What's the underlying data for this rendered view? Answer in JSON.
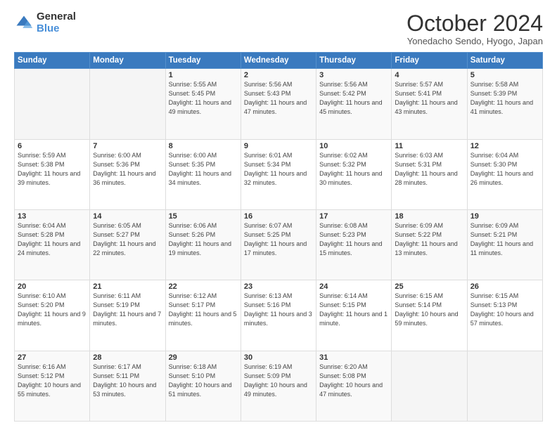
{
  "logo": {
    "general": "General",
    "blue": "Blue"
  },
  "header": {
    "month": "October 2024",
    "location": "Yonedacho Sendo, Hyogo, Japan"
  },
  "weekdays": [
    "Sunday",
    "Monday",
    "Tuesday",
    "Wednesday",
    "Thursday",
    "Friday",
    "Saturday"
  ],
  "weeks": [
    [
      {
        "day": "",
        "detail": ""
      },
      {
        "day": "",
        "detail": ""
      },
      {
        "day": "1",
        "detail": "Sunrise: 5:55 AM\nSunset: 5:45 PM\nDaylight: 11 hours and 49 minutes."
      },
      {
        "day": "2",
        "detail": "Sunrise: 5:56 AM\nSunset: 5:43 PM\nDaylight: 11 hours and 47 minutes."
      },
      {
        "day": "3",
        "detail": "Sunrise: 5:56 AM\nSunset: 5:42 PM\nDaylight: 11 hours and 45 minutes."
      },
      {
        "day": "4",
        "detail": "Sunrise: 5:57 AM\nSunset: 5:41 PM\nDaylight: 11 hours and 43 minutes."
      },
      {
        "day": "5",
        "detail": "Sunrise: 5:58 AM\nSunset: 5:39 PM\nDaylight: 11 hours and 41 minutes."
      }
    ],
    [
      {
        "day": "6",
        "detail": "Sunrise: 5:59 AM\nSunset: 5:38 PM\nDaylight: 11 hours and 39 minutes."
      },
      {
        "day": "7",
        "detail": "Sunrise: 6:00 AM\nSunset: 5:36 PM\nDaylight: 11 hours and 36 minutes."
      },
      {
        "day": "8",
        "detail": "Sunrise: 6:00 AM\nSunset: 5:35 PM\nDaylight: 11 hours and 34 minutes."
      },
      {
        "day": "9",
        "detail": "Sunrise: 6:01 AM\nSunset: 5:34 PM\nDaylight: 11 hours and 32 minutes."
      },
      {
        "day": "10",
        "detail": "Sunrise: 6:02 AM\nSunset: 5:32 PM\nDaylight: 11 hours and 30 minutes."
      },
      {
        "day": "11",
        "detail": "Sunrise: 6:03 AM\nSunset: 5:31 PM\nDaylight: 11 hours and 28 minutes."
      },
      {
        "day": "12",
        "detail": "Sunrise: 6:04 AM\nSunset: 5:30 PM\nDaylight: 11 hours and 26 minutes."
      }
    ],
    [
      {
        "day": "13",
        "detail": "Sunrise: 6:04 AM\nSunset: 5:28 PM\nDaylight: 11 hours and 24 minutes."
      },
      {
        "day": "14",
        "detail": "Sunrise: 6:05 AM\nSunset: 5:27 PM\nDaylight: 11 hours and 22 minutes."
      },
      {
        "day": "15",
        "detail": "Sunrise: 6:06 AM\nSunset: 5:26 PM\nDaylight: 11 hours and 19 minutes."
      },
      {
        "day": "16",
        "detail": "Sunrise: 6:07 AM\nSunset: 5:25 PM\nDaylight: 11 hours and 17 minutes."
      },
      {
        "day": "17",
        "detail": "Sunrise: 6:08 AM\nSunset: 5:23 PM\nDaylight: 11 hours and 15 minutes."
      },
      {
        "day": "18",
        "detail": "Sunrise: 6:09 AM\nSunset: 5:22 PM\nDaylight: 11 hours and 13 minutes."
      },
      {
        "day": "19",
        "detail": "Sunrise: 6:09 AM\nSunset: 5:21 PM\nDaylight: 11 hours and 11 minutes."
      }
    ],
    [
      {
        "day": "20",
        "detail": "Sunrise: 6:10 AM\nSunset: 5:20 PM\nDaylight: 11 hours and 9 minutes."
      },
      {
        "day": "21",
        "detail": "Sunrise: 6:11 AM\nSunset: 5:19 PM\nDaylight: 11 hours and 7 minutes."
      },
      {
        "day": "22",
        "detail": "Sunrise: 6:12 AM\nSunset: 5:17 PM\nDaylight: 11 hours and 5 minutes."
      },
      {
        "day": "23",
        "detail": "Sunrise: 6:13 AM\nSunset: 5:16 PM\nDaylight: 11 hours and 3 minutes."
      },
      {
        "day": "24",
        "detail": "Sunrise: 6:14 AM\nSunset: 5:15 PM\nDaylight: 11 hours and 1 minute."
      },
      {
        "day": "25",
        "detail": "Sunrise: 6:15 AM\nSunset: 5:14 PM\nDaylight: 10 hours and 59 minutes."
      },
      {
        "day": "26",
        "detail": "Sunrise: 6:15 AM\nSunset: 5:13 PM\nDaylight: 10 hours and 57 minutes."
      }
    ],
    [
      {
        "day": "27",
        "detail": "Sunrise: 6:16 AM\nSunset: 5:12 PM\nDaylight: 10 hours and 55 minutes."
      },
      {
        "day": "28",
        "detail": "Sunrise: 6:17 AM\nSunset: 5:11 PM\nDaylight: 10 hours and 53 minutes."
      },
      {
        "day": "29",
        "detail": "Sunrise: 6:18 AM\nSunset: 5:10 PM\nDaylight: 10 hours and 51 minutes."
      },
      {
        "day": "30",
        "detail": "Sunrise: 6:19 AM\nSunset: 5:09 PM\nDaylight: 10 hours and 49 minutes."
      },
      {
        "day": "31",
        "detail": "Sunrise: 6:20 AM\nSunset: 5:08 PM\nDaylight: 10 hours and 47 minutes."
      },
      {
        "day": "",
        "detail": ""
      },
      {
        "day": "",
        "detail": ""
      }
    ]
  ]
}
